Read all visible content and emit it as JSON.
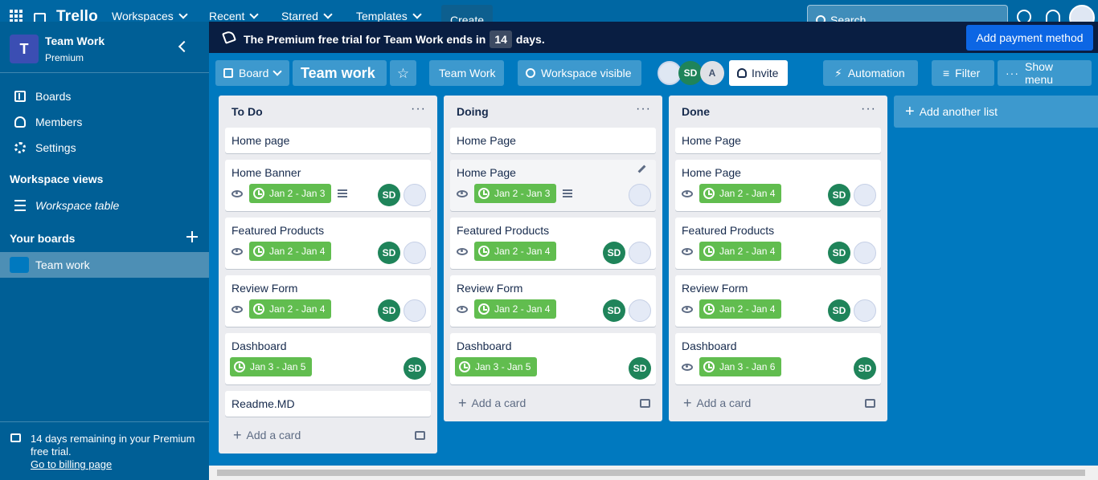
{
  "topbar": {
    "logo": "Trello",
    "menu": [
      "Workspaces",
      "Recent",
      "Starred",
      "Templates"
    ],
    "create": "Create",
    "search_placeholder": "Search"
  },
  "sidebar": {
    "workspace_initial": "T",
    "workspace_name": "Team Work",
    "workspace_plan": "Premium",
    "nav": [
      "Boards",
      "Members",
      "Settings"
    ],
    "views_title": "Workspace views",
    "views_item": "Workspace table",
    "boards_title": "Your boards",
    "board_item": "Team work",
    "trial_text": "14 days remaining in your Premium free trial.",
    "trial_link": "Go to billing page"
  },
  "banner": {
    "before": "The Premium free trial for Team Work ends in",
    "count": "14",
    "after": "days.",
    "button": "Add payment method"
  },
  "board_header": {
    "view": "Board",
    "title": "Team work",
    "workspace": "Team Work",
    "visibility": "Workspace visible",
    "members": [
      "SD",
      "A"
    ],
    "invite": "Invite",
    "automation": "Automation",
    "filter": "Filter",
    "show_menu": "Show menu"
  },
  "lists": [
    {
      "title": "To Do",
      "cards": [
        {
          "title": "Home page"
        },
        {
          "title": "Home Banner",
          "date": "Jan 2 - Jan 3",
          "member": "SD"
        },
        {
          "title": "Featured Products",
          "date": "Jan 2 - Jan 4",
          "member": "SD"
        },
        {
          "title": "Review Form",
          "date": "Jan 2 - Jan 4",
          "member": "SD"
        },
        {
          "title": "Dashboard",
          "date": "Jan 3 - Jan 5",
          "member": "SD"
        },
        {
          "title": "Readme.MD"
        }
      ],
      "add_card": "Add a card"
    },
    {
      "title": "Doing",
      "cards": [
        {
          "title": "Home Page"
        },
        {
          "title": "Home Page",
          "date": "Jan 2 - Jan 3"
        },
        {
          "title": "Featured Products",
          "date": "Jan 2 - Jan 4",
          "member": "SD"
        },
        {
          "title": "Review Form",
          "date": "Jan 2 - Jan 4",
          "member": "SD"
        },
        {
          "title": "Dashboard",
          "date": "Jan 3 - Jan 5",
          "member": "SD"
        }
      ],
      "add_card": "Add a card"
    },
    {
      "title": "Done",
      "cards": [
        {
          "title": "Home Page"
        },
        {
          "title": "Home Page",
          "date": "Jan 2 - Jan 4",
          "member": "SD"
        },
        {
          "title": "Featured Products",
          "date": "Jan 2 - Jan 4",
          "member": "SD"
        },
        {
          "title": "Review Form",
          "date": "Jan 2 - Jan 4",
          "member": "SD"
        },
        {
          "title": "Dashboard",
          "date": "Jan 3 - Jan 6",
          "member": "SD"
        }
      ],
      "add_card": "Add a card"
    }
  ],
  "add_list": "Add another list",
  "colors": {
    "board_bg": "#0079bf",
    "date_badge": "#61bd4f",
    "member_sd": "#1f845a"
  }
}
